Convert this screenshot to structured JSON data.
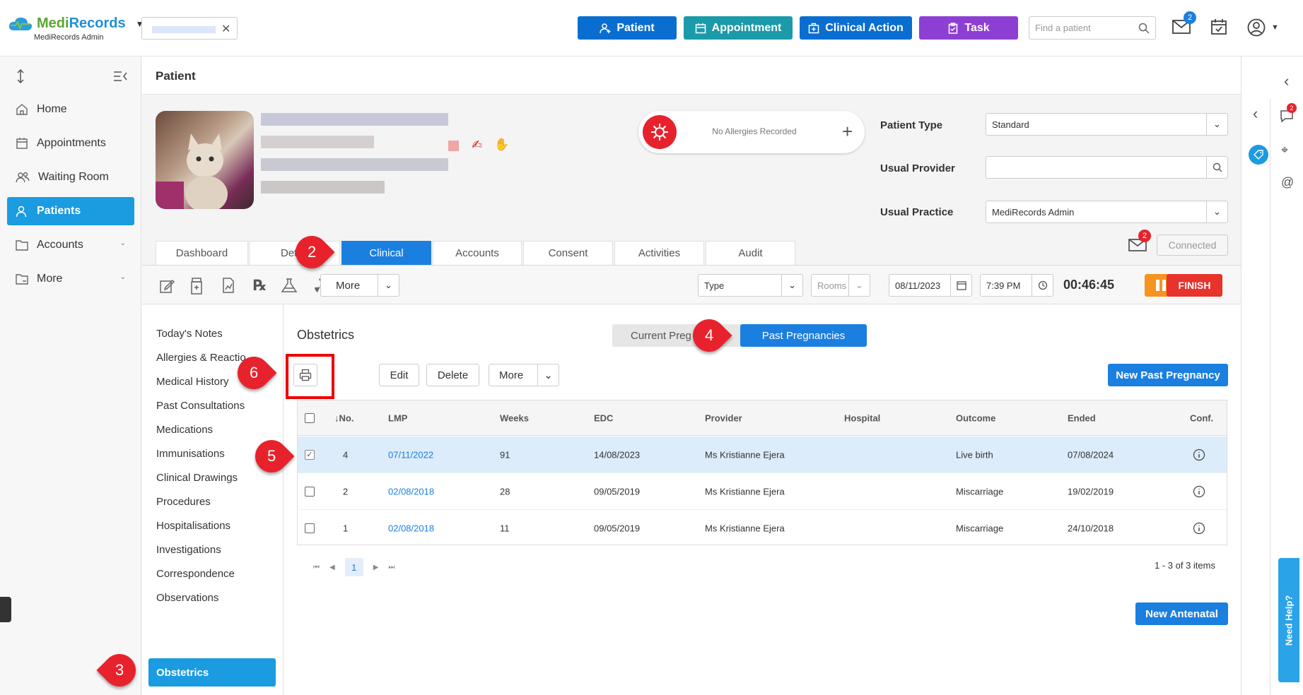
{
  "brand": {
    "name_a": "Medi",
    "name_b": "Records",
    "sub": "MediRecords Admin"
  },
  "header": {
    "buttons": [
      {
        "label": "Patient",
        "color": "#0a6ed1"
      },
      {
        "label": "Appointment",
        "color": "#1b9aaa"
      },
      {
        "label": "Clinical Action",
        "color": "#0a6ed1"
      },
      {
        "label": "Task",
        "color": "#8e3fd3"
      }
    ],
    "search_placeholder": "Find a patient",
    "mail_badge": "2"
  },
  "nav": {
    "items": [
      "Home",
      "Appointments",
      "Waiting Room",
      "Patients",
      "Accounts",
      "More"
    ]
  },
  "page": {
    "title": "Patient"
  },
  "patient": {
    "allergy": "No Allergies Recorded",
    "fields": [
      {
        "label": "Patient Type",
        "value": "Standard"
      },
      {
        "label": "Usual Provider",
        "value": ""
      },
      {
        "label": "Usual Practice",
        "value": "MediRecords Admin"
      }
    ],
    "msg_badge": "2",
    "connected": "Connected"
  },
  "tabs": [
    "Dashboard",
    "Det",
    "Clinical",
    "Accounts",
    "Consent",
    "Activities",
    "Audit"
  ],
  "toolbar": {
    "more": "More",
    "type": "Type",
    "rooms": "Rooms",
    "date": "08/11/2023",
    "time": "7:39 PM",
    "timer": "00:46:45",
    "finish": "FINISH"
  },
  "subnav": [
    "Today's Notes",
    "Allergies & Reactio",
    "Medical History",
    "Past Consultations",
    "Medications",
    "Immunisations",
    "Clinical Drawings",
    "Procedures",
    "Hospitalisations",
    "Investigations",
    "Correspondence",
    "Observations",
    "Obstetrics"
  ],
  "content": {
    "title": "Obstetrics",
    "toggle": [
      "Current Preg",
      "Past Pregnancies"
    ],
    "actions": [
      "Edit",
      "Delete",
      "More"
    ],
    "new_past": "New Past Pregnancy",
    "new_antenatal": "New Antenatal",
    "paging": "1 - 3 of 3 items",
    "page_num": "1"
  },
  "table": {
    "headers": [
      "No.",
      "LMP",
      "Weeks",
      "EDC",
      "Provider",
      "Hospital",
      "Outcome",
      "Ended",
      "Conf."
    ],
    "rows": [
      {
        "no": "4",
        "lmp": "07/11/2022",
        "weeks": "91",
        "edc": "14/08/2023",
        "provider": "Ms Kristianne Ejera",
        "hospital": "",
        "outcome": "Live birth",
        "ended": "07/08/2024"
      },
      {
        "no": "2",
        "lmp": "02/08/2018",
        "weeks": "28",
        "edc": "09/05/2019",
        "provider": "Ms Kristianne Ejera",
        "hospital": "",
        "outcome": "Miscarriage",
        "ended": "19/02/2019"
      },
      {
        "no": "1",
        "lmp": "02/08/2018",
        "weeks": "11",
        "edc": "09/05/2019",
        "provider": "Ms Kristianne Ejera",
        "hospital": "",
        "outcome": "Miscarriage",
        "ended": "24/10/2018"
      }
    ]
  },
  "markers": [
    "2",
    "3",
    "4",
    "5",
    "6"
  ],
  "help": "Need Help?",
  "rightbar_badge": "2"
}
